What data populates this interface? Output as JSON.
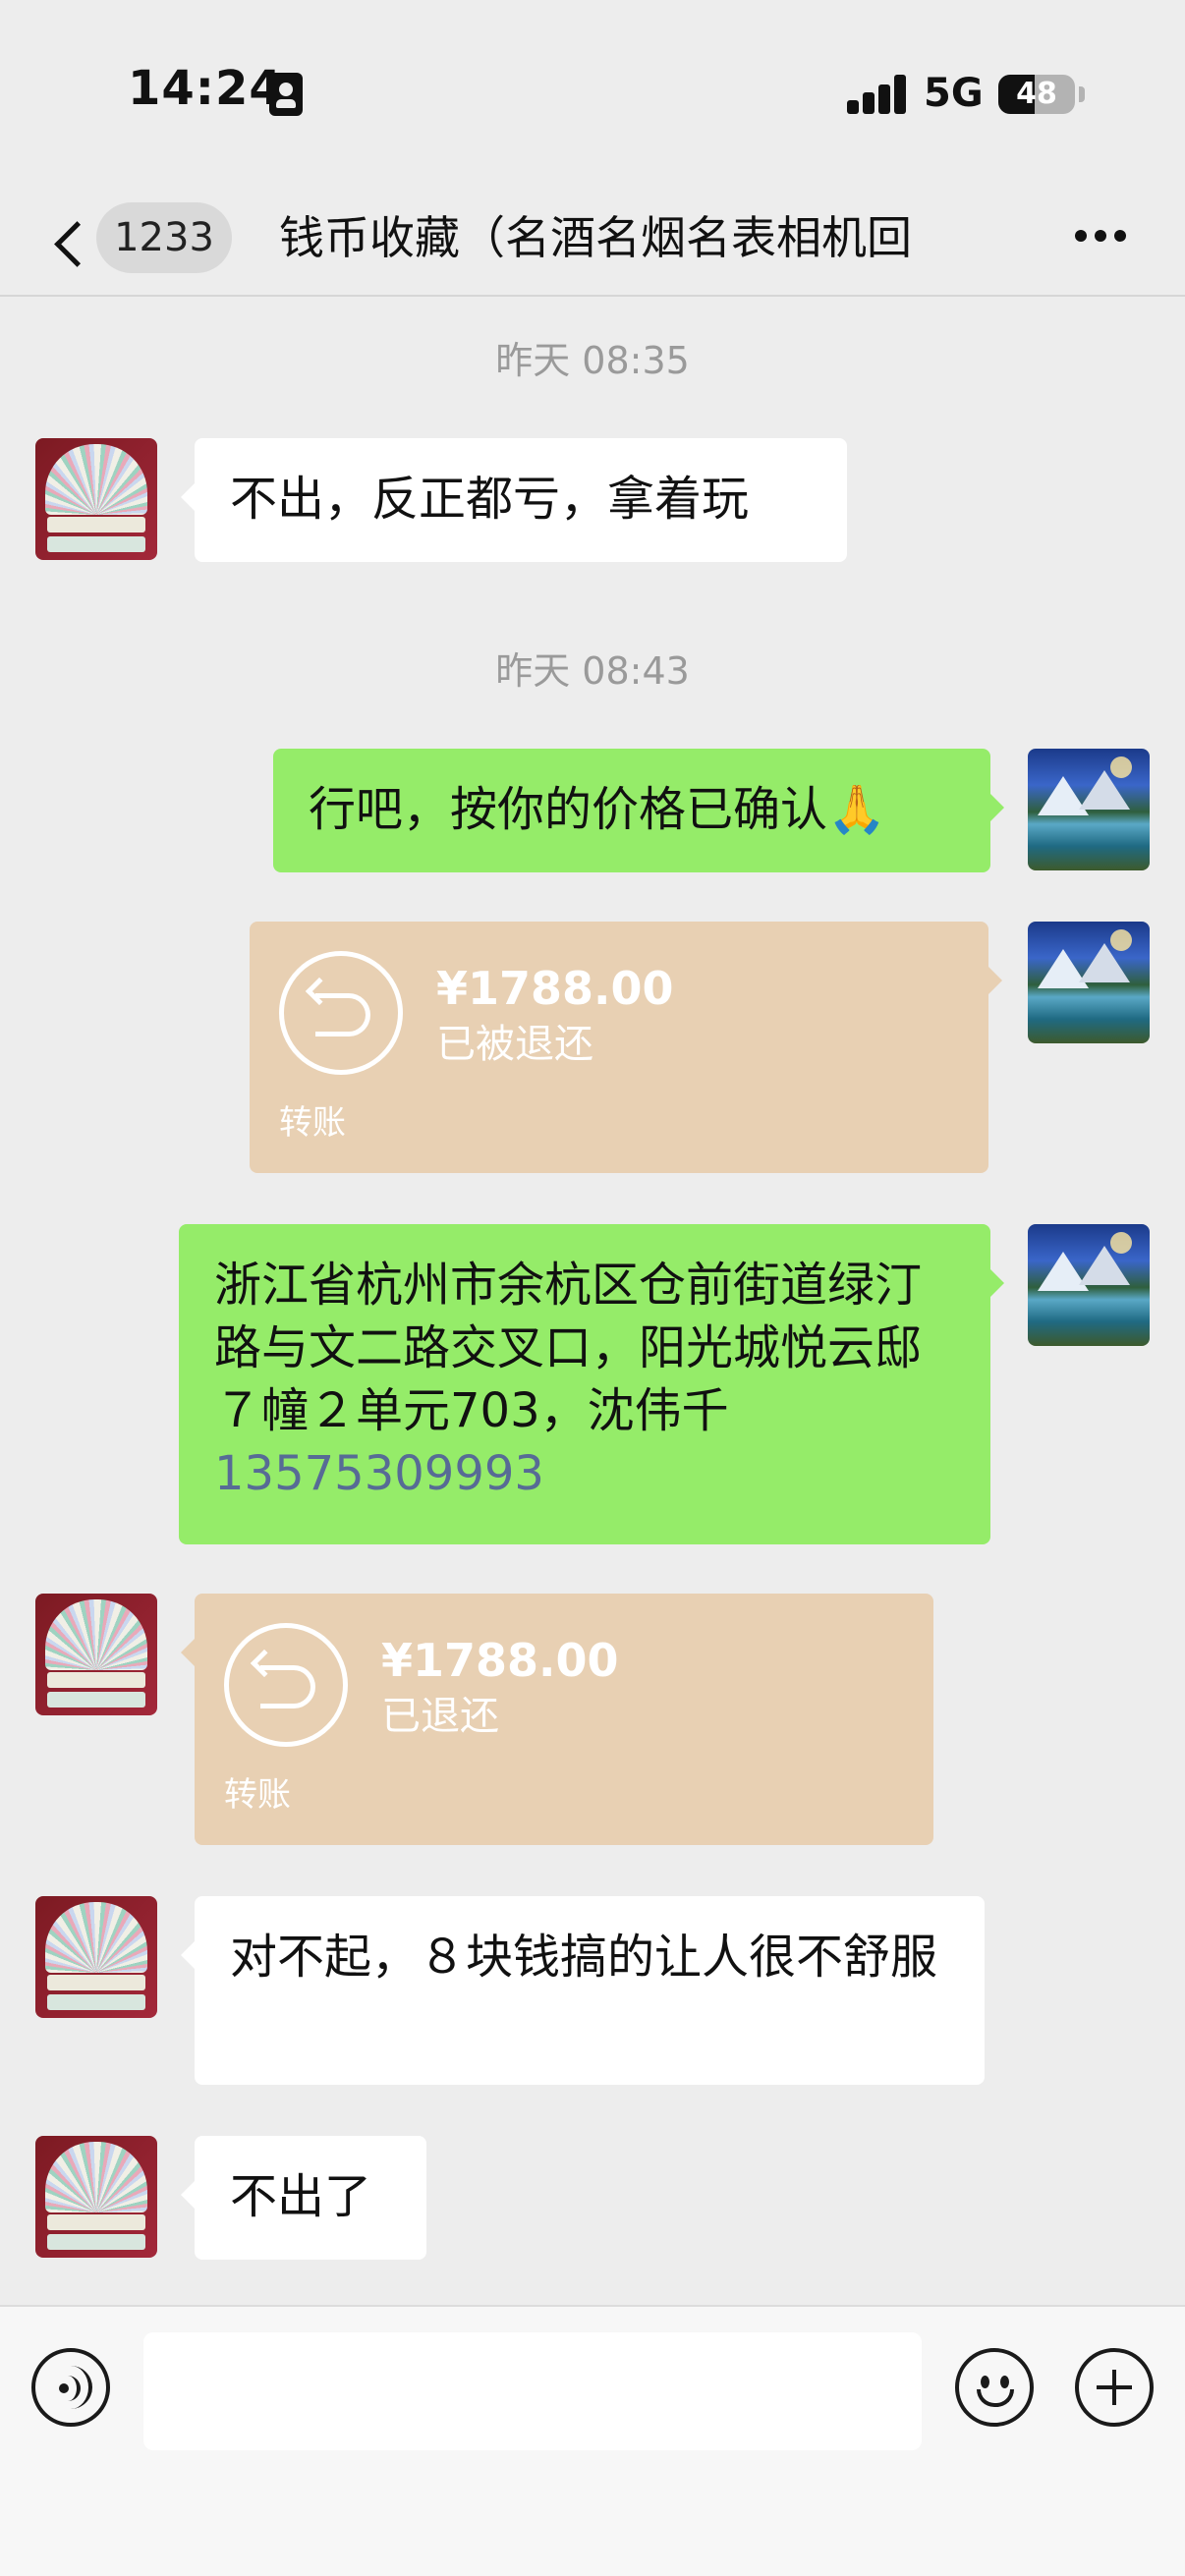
{
  "status_bar": {
    "time": "14:24",
    "network": "5G",
    "battery_level": "48",
    "battery_fraction": 0.48,
    "icons": [
      "sim-card-icon",
      "signal-icon",
      "battery-icon"
    ]
  },
  "nav": {
    "unread_count": "1233",
    "title": "钱币收藏（名酒名烟名表相机回",
    "icons": [
      "back-icon",
      "more-icon"
    ]
  },
  "messages": {
    "ts1": "昨天 08:35",
    "m1": "不出，反正都亏，拿着玩",
    "ts2": "昨天 08:43",
    "m2": "行吧，按你的价格已确认🙏",
    "t1_amount": "¥1788.00",
    "t1_status": "已被退还",
    "t1_label": "转账",
    "m3_text": "浙江省杭州市余杭区仓前街道绿汀路与文二路交叉口，阳光城悦云邸７幢２单元703，沈伟千",
    "m3_phone": "13575309993",
    "t2_amount": "¥1788.00",
    "t2_status": "已退还",
    "t2_label": "转账",
    "m4": "对不起，８块钱搞的让人很不舒服",
    "m5": "不出了"
  },
  "input_bar": {
    "value": "",
    "icons": [
      "voice-icon",
      "emoji-icon",
      "plus-icon"
    ]
  },
  "colors": {
    "background": "#ededed",
    "green_bubble": "#95ec69",
    "white_bubble": "#ffffff",
    "transfer_bubble": "#e8d0b3",
    "link": "#576b95",
    "timestamp": "#9a9a9a"
  }
}
